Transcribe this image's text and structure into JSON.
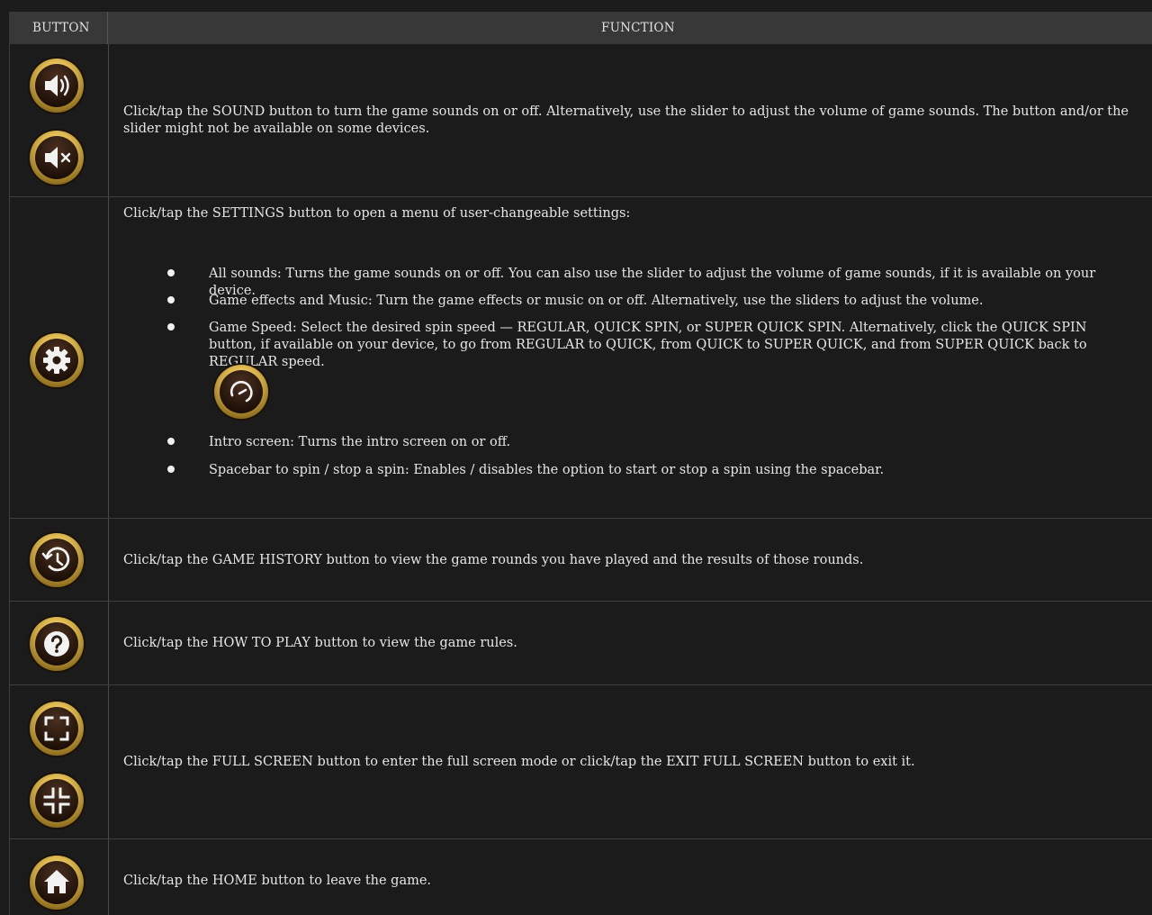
{
  "header": {
    "button_col": "BUTTON",
    "function_col": "FUNCTION"
  },
  "rows": {
    "sound": {
      "text": "Click/tap the SOUND button to turn the game sounds on or off. Alternatively, use the slider to adjust the volume of game sounds. The button and/or the slider might not be available on some devices."
    },
    "settings": {
      "intro": "Click/tap the SETTINGS button to open a menu of user-changeable settings:",
      "items": [
        "All sounds: Turns the game sounds on or off. You can also use the slider to adjust the volume of game sounds, if it is available on your device.",
        "Game effects and Music: Turn the game effects or music on or off. Alternatively, use the sliders to adjust the volume.",
        "Game Speed: Select the desired spin speed — REGULAR, QUICK SPIN, or SUPER QUICK SPIN. Alternatively, click the QUICK SPIN button, if available on your device, to go from REGULAR to QUICK, from QUICK to SUPER QUICK, and from SUPER QUICK back to REGULAR speed.",
        "Intro screen: Turns the intro screen on or off.",
        "Spacebar to spin / stop a spin: Enables / disables the option to start or stop a spin using the spacebar."
      ]
    },
    "history": {
      "text": "Click/tap the GAME HISTORY button to view the game rounds you have played and the results of those rounds."
    },
    "howto": {
      "text": "Click/tap the HOW TO PLAY button to view the game rules."
    },
    "fullscreen": {
      "text": "Click/tap the FULL SCREEN button to enter the full screen mode or click/tap the EXIT FULL SCREEN button to exit it."
    },
    "home": {
      "text": "Click/tap the HOME button to leave the game."
    }
  },
  "icons": [
    "sound-on-icon",
    "sound-off-icon",
    "settings-gear-icon",
    "quick-spin-icon",
    "history-icon",
    "help-icon",
    "fullscreen-enter-icon",
    "fullscreen-exit-icon",
    "home-icon"
  ],
  "colors": {
    "background": "#1b1b1b",
    "header_bg": "#383838",
    "icon_ring": "#d9b24a",
    "icon_inner": "#2a1a10"
  }
}
